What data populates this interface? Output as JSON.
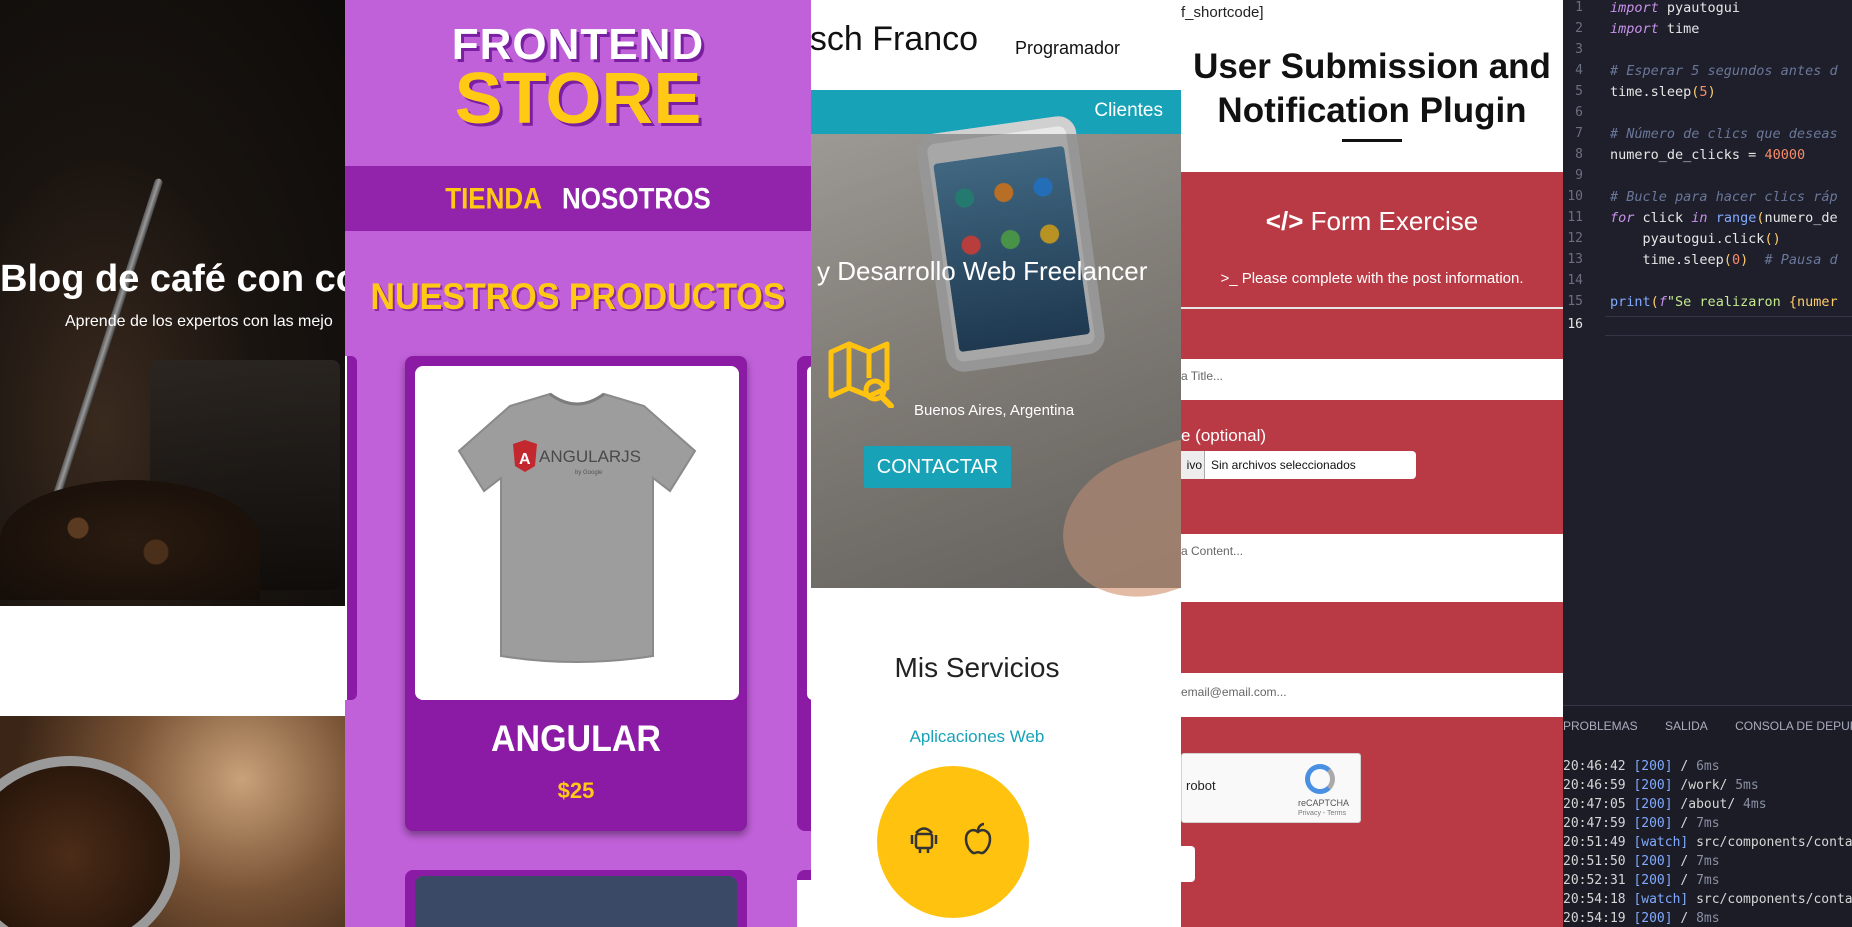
{
  "blog": {
    "title": "Blog de café con con",
    "subtitle": "Aprende de los expertos con las mejo"
  },
  "store": {
    "logo_top": "FRONTEND",
    "logo_bottom": "STORE",
    "nav": [
      "TIENDA",
      "NOSOTROS"
    ],
    "section_title": "NUESTROS PRODUCTOS",
    "product": {
      "name": "ANGULAR",
      "price": "$25",
      "brand": "ANGULARJS",
      "brand_sub": "by Google"
    }
  },
  "freelancer": {
    "name": "usch Franco",
    "role": "Programador",
    "nav_item": "Clientes",
    "headline": "y Desarrollo Web Freelancer",
    "location": "Buenos Aires, Argentina",
    "cta": "CONTACTAR",
    "services_title": "Mis Servicios",
    "service_1": "Aplicaciones Web"
  },
  "form": {
    "shortcode": "f_shortcode]",
    "heading": "User Submission and Notification Plugin",
    "title": "Form Exercise",
    "subtitle": "Please complete with the post information.",
    "title_placeholder": "a Title...",
    "file_label": "e (optional)",
    "file_button": "ivo",
    "file_none": "Sin archivos seleccionados",
    "content_placeholder": "a Content...",
    "email_placeholder": "email@email.com...",
    "captcha_text": "robot",
    "captcha_brand": "reCAPTCHA",
    "captcha_links": "Privacy - Terms"
  },
  "editor": {
    "line_numbers": [
      "1",
      "2",
      "3",
      "4",
      "5",
      "6",
      "7",
      "8",
      "9",
      "10",
      "11",
      "12",
      "13",
      "14",
      "15",
      "16"
    ],
    "active_line": "16",
    "lines": {
      "l1_kw": "import",
      "l1_rest": " pyautogui",
      "l2_kw": "import",
      "l2_rest": " time",
      "l4": "# Esperar 5 segundos antes d",
      "l5_a": "time.sleep",
      "l5_p1": "(",
      "l5_n": "5",
      "l5_p2": ")",
      "l7": "# Número de clics que deseas",
      "l8_a": "numero_de_clicks = ",
      "l8_n": "40000",
      "l10": "# Bucle para hacer clics ráp",
      "l11_kw": "for",
      "l11_a": " click ",
      "l11_in": "in",
      "l11_b": " ",
      "l11_fn": "range",
      "l11_p": "(",
      "l11_c": "numero_de",
      "l12_a": "    pyautogui.click",
      "l12_p": "()",
      "l13_a": "    time.sleep",
      "l13_p1": "(",
      "l13_n": "0",
      "l13_p2": ")",
      "l13_cm": "  # Pausa d",
      "l15_fn": "print",
      "l15_p": "(",
      "l15_f": "f",
      "l15_s": "\"Se realizaron ",
      "l15_b": "{numer"
    },
    "terminal_tabs": [
      "PROBLEMAS",
      "SALIDA",
      "CONSOLA DE DEPURACI"
    ],
    "terminal": [
      {
        "time": "20:46:42",
        "tag": "[200]",
        "path": " / ",
        "ms": "6ms"
      },
      {
        "time": "20:46:59",
        "tag": "[200]",
        "path": " /work/ ",
        "ms": "5ms"
      },
      {
        "time": "20:47:05",
        "tag": "[200]",
        "path": " /about/ ",
        "ms": "4ms"
      },
      {
        "time": "20:47:59",
        "tag": "[200]",
        "path": " / ",
        "ms": "7ms"
      },
      {
        "time": "20:51:49",
        "tag": "[watch]",
        "path": " src/components/contac",
        "ms": ""
      },
      {
        "time": "20:51:50",
        "tag": "[200]",
        "path": " / ",
        "ms": "7ms"
      },
      {
        "time": "20:52:31",
        "tag": "[200]",
        "path": " / ",
        "ms": "7ms"
      },
      {
        "time": "20:54:18",
        "tag": "[watch]",
        "path": " src/components/contac",
        "ms": ""
      },
      {
        "time": "20:54:19",
        "tag": "[200]",
        "path": " / ",
        "ms": "8ms"
      }
    ]
  }
}
